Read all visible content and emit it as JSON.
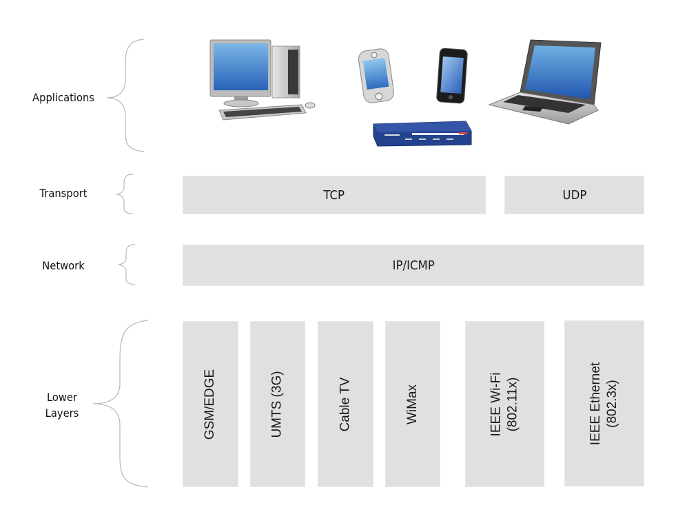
{
  "diagram": {
    "type": "protocol-stack",
    "layers": [
      {
        "id": "applications",
        "label": "Applications"
      },
      {
        "id": "transport",
        "label": "Transport"
      },
      {
        "id": "network",
        "label": "Network"
      },
      {
        "id": "lower",
        "label": "Lower\nLayers"
      }
    ],
    "devices": [
      {
        "name": "desktop-computer",
        "label": ""
      },
      {
        "name": "pda",
        "label": ""
      },
      {
        "name": "smartphone",
        "label": ""
      },
      {
        "name": "router",
        "label": ""
      },
      {
        "name": "laptop",
        "label": ""
      }
    ],
    "transport": {
      "tcp": "TCP",
      "udp": "UDP"
    },
    "network": {
      "ip": "IP/ICMP"
    },
    "lower": [
      "GSM/EDGE",
      "UMTS (3G)",
      "Cable TV",
      "WiMax",
      "IEEE Wi-Fi\n(802.11x)",
      "IEEE Ethernet\n(802.3x)"
    ],
    "colors": {
      "box": "#e0e0e0",
      "brace": "#b0b0b0",
      "screen": "#3a7fd0",
      "router": "#1f3e8f"
    }
  }
}
